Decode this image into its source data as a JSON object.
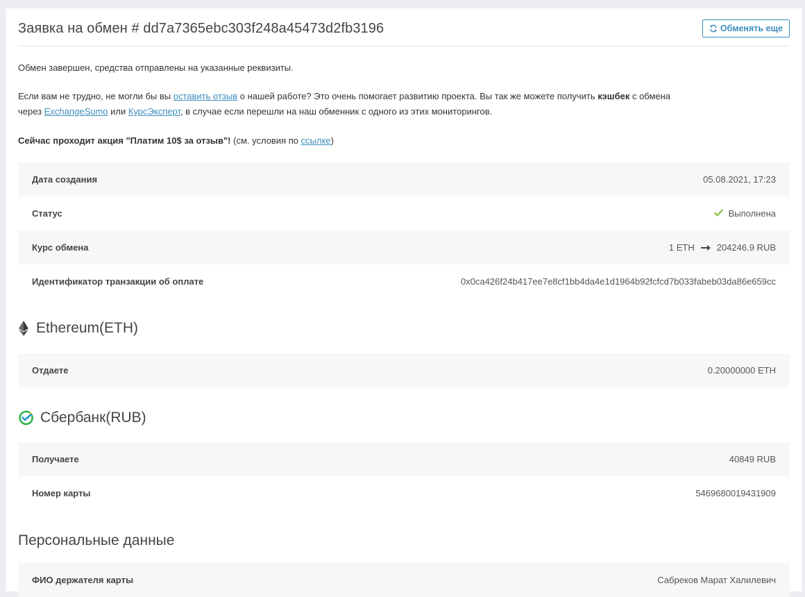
{
  "header": {
    "title": "Заявка на обмен # dd7a7365ebc303f248a45473d2fb3196",
    "button_label": "Обменять еще"
  },
  "intro": {
    "completed_text": "Обмен завершен, средства отправлены на указанные реквизиты.",
    "review_line1_a": "Если вам не трудно, не могли бы вы ",
    "review_link": "оставить отзыв",
    "review_line1_b": " о нашей работе? Это очень помогает развитию проекта. Вы так же можете получить ",
    "cashback_bold": "кэшбек",
    "review_line1_c": " с обмена",
    "review_line2_a": "через ",
    "exchangesumo_link": "ExchangeSumo",
    "review_line2_b": " или ",
    "kursexpert_link": "КурсЭксперт",
    "review_line2_c": ", в случае если перешли на наш обменник с одного из этих мониторингов.",
    "promo_bold": "Сейчас проходит акция \"Платим 10$ за отзыв\"!",
    "promo_text": " (см. условия по ",
    "promo_link": "ссылке",
    "promo_close": ")"
  },
  "details": {
    "created_label": "Дата создания",
    "created_value": "05.08.2021, 17:23",
    "status_label": "Статус",
    "status_value": "Выполнена",
    "rate_label": "Курс обмена",
    "rate_from": "1 ETH",
    "rate_to": "204246.9 RUB",
    "txid_label": "Идентификатор транзакции об оплате",
    "txid_value": "0x0ca426f24b417ee7e8cf1bb4da4e1d1964b92fcfcd7b033fabeb03da86e659cc"
  },
  "give": {
    "title": "Ethereum(ETH)",
    "label": "Отдаете",
    "value": "0.20000000 ETH"
  },
  "receive": {
    "title": "Сбербанк(RUB)",
    "amount_label": "Получаете",
    "amount_value": "40849 RUB",
    "card_label": "Номер карты",
    "card_value": "5469680019431909"
  },
  "personal": {
    "title": "Персональные данные",
    "holder_label": "ФИО держателя карты",
    "holder_value": "Сабреков Марат Халилевич"
  },
  "colors": {
    "accent": "#3c8dbc",
    "success": "#8bc34a",
    "row_bg": "#f7f7f7"
  }
}
